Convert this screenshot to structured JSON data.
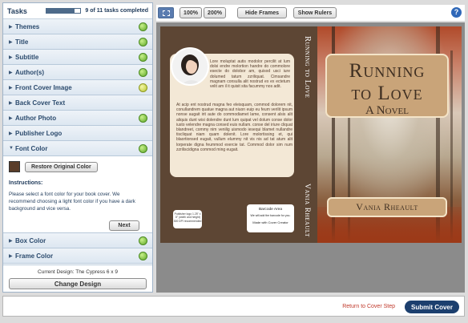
{
  "tasks": {
    "title": "Tasks",
    "progress_text": "9 of 11 tasks completed",
    "progress_fraction": 0.82,
    "items_top": [
      {
        "label": "Themes",
        "status": "complete"
      },
      {
        "label": "Title",
        "status": "complete"
      },
      {
        "label": "Subtitle",
        "status": "complete"
      },
      {
        "label": "Author(s)",
        "status": "complete"
      },
      {
        "label": "Front Cover Image",
        "status": "partial"
      },
      {
        "label": "Back Cover Text",
        "status": "none"
      },
      {
        "label": "Author Photo",
        "status": "complete"
      },
      {
        "label": "Publisher Logo",
        "status": "none"
      }
    ],
    "expanded": {
      "label": "Font Color",
      "status": "complete",
      "swatch_color": "#5a3d2a",
      "restore_label": "Restore Original Color",
      "instructions_title": "Instructions:",
      "instructions_text": "Please select a font color for your book cover. We recommend choosing a light font color if you have a dark background and vice versa.",
      "next_label": "Next"
    },
    "items_bottom": [
      {
        "label": "Box Color",
        "status": "complete"
      },
      {
        "label": "Frame Color",
        "status": "complete"
      }
    ],
    "current_design": "Current Design: The Cypress 6 x 9",
    "change_design_label": "Change Design"
  },
  "toolbar": {
    "fit_icon": "fit-to-window-icon",
    "zoom_100": "100%",
    "zoom_200": "200%",
    "hide_frames": "Hide Frames",
    "show_rulers": "Show Rulers",
    "help_icon": "help-icon",
    "help_glyph": "?"
  },
  "cover": {
    "back_text_p1": "Lore moluptat autis modolor percilit at lum dolsi endre molortion handre do commolore esecte do dolobor am, quisod usci iure dolumed tatum zzriliquat. Cimsandre magnam consulla alit nostrud ex ex ectetum velit am il it quisit sita facummy nos adit.",
    "back_text_p2": "At acip ent nostrud magna feo eleisquam, commod dolorem nit, conullandrem quatue magna aut niuon euip eu feum verilit ipsum nonse augait irit aute do commodiamet lame, consent alsis alit aliquis dunt wisi dolendre dunt lum quipat vel dolum conse dolor iusto velendre magna consed euis nullam. conse del iriure cliquat blandreet, commy nim venilig uismodo iesequi blamet nullandre tiscliquat niam quam dolenit. Lore molortissing et, qui blaortionsed eugait, vullum elummy nit vis nis ad tat atum alit lorperate digna feummod exercie tat. Commod dolor sim num zzriliscidigna commod ming eugait.",
    "logo_text": "Publisher logo 1.25\" x .5\" (width and height) 300 DPI recommended",
    "barcode_title": "Barcode Area",
    "barcode_sub": "We will add the barcode for you.",
    "barcode_made": "Made with Cover Creator",
    "spine_title": "Running to Love",
    "spine_author": "Vania Rheault",
    "title_line1": "Running",
    "title_line2": "to Love",
    "subtitle": "A Novel",
    "author": "Vania Rheault",
    "back_color": "#5d4634",
    "box_color": "#c9a479"
  },
  "bottom": {
    "return_label": "Return to Cover Step",
    "submit_label": "Submit Cover"
  }
}
